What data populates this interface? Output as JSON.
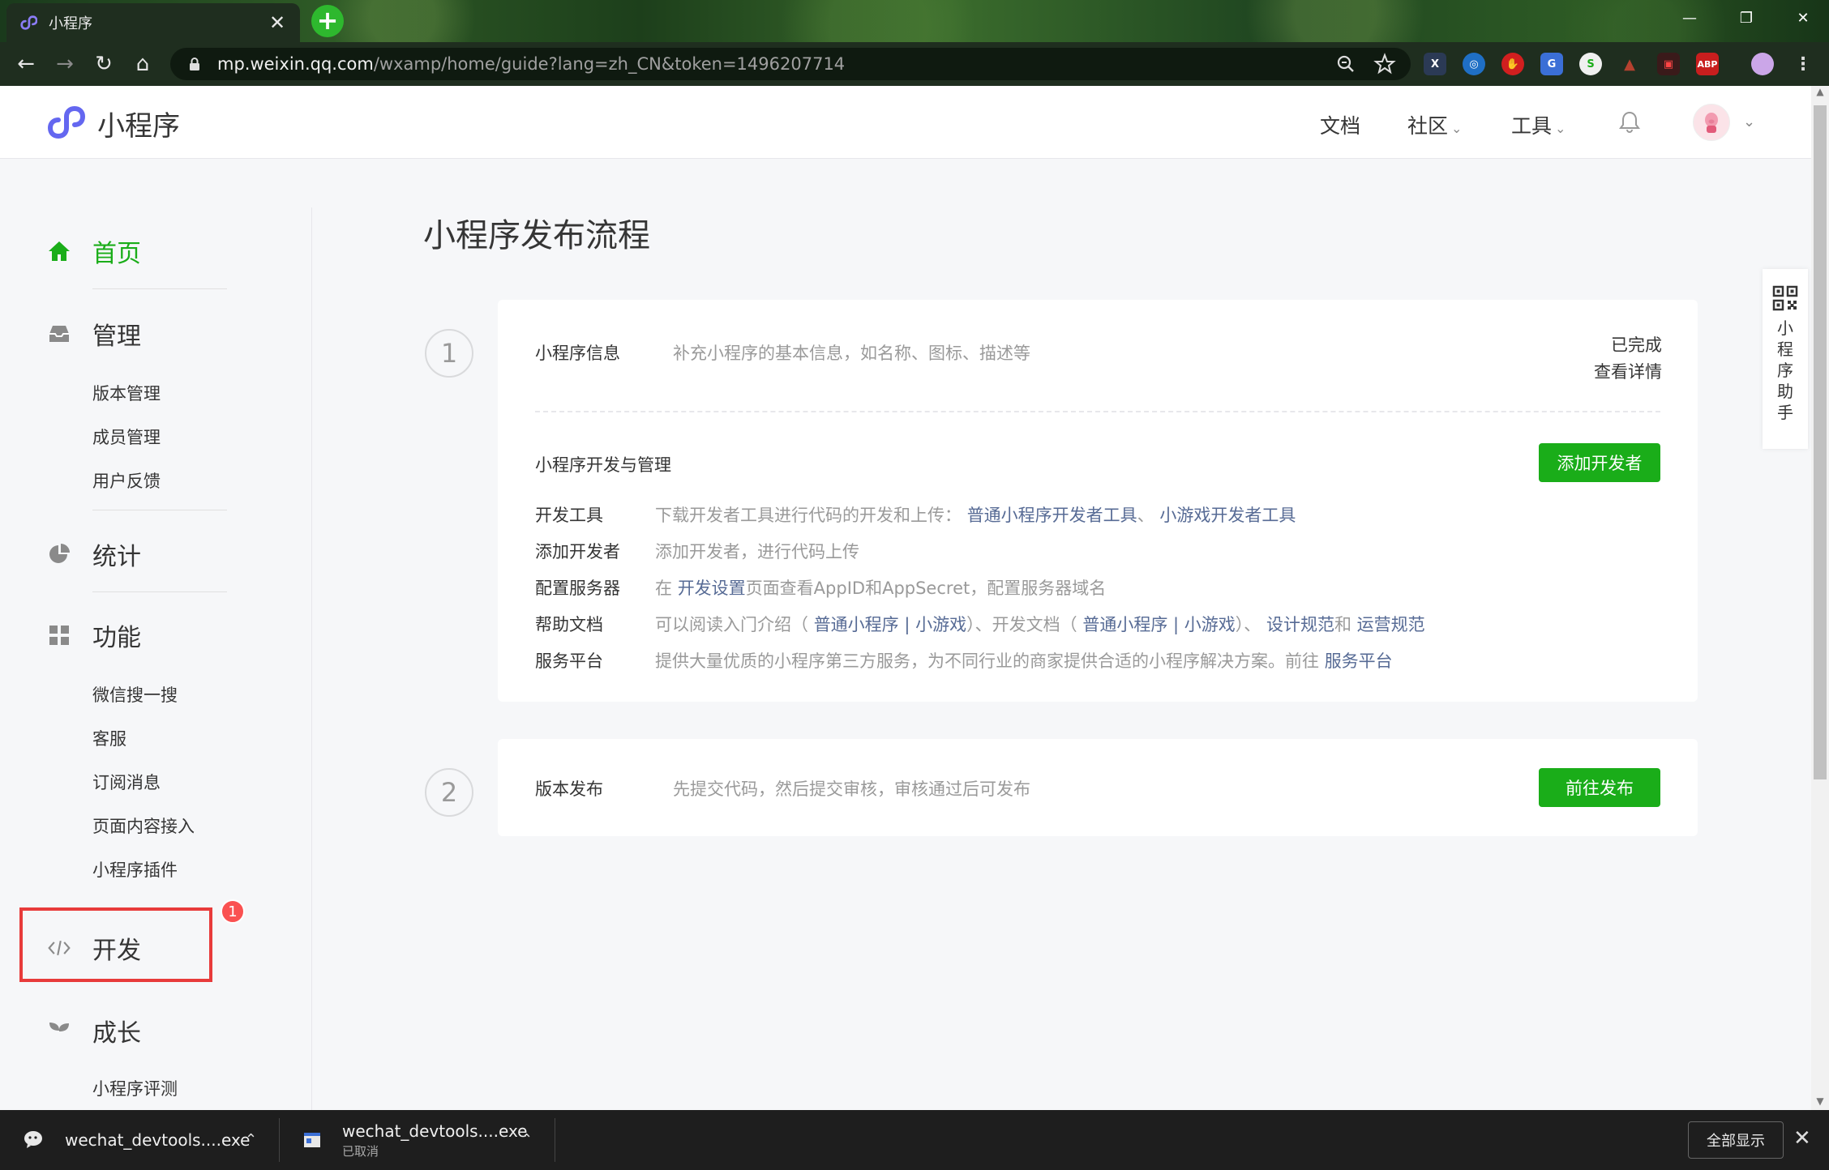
{
  "browser": {
    "tab_title": "小程序",
    "tab_close": "✕",
    "new_tab": "+",
    "url_host": "mp.weixin.qq.com",
    "url_path": "/wxamp/home/guide?lang=zh_CN&token=1496207714",
    "window_controls": {
      "minimize": "—",
      "restore": "❐",
      "close": "✕"
    },
    "nav": {
      "back": "←",
      "forward": "→",
      "reload": "↻",
      "home": "⌂"
    },
    "extensions": [
      "X",
      "◎",
      "✋",
      "G",
      "S",
      "▲",
      "▣",
      "ABP"
    ]
  },
  "header": {
    "logo_text": "小程序",
    "links": {
      "docs": "文档",
      "community": "社区",
      "tools": "工具"
    },
    "chevron": "⌄",
    "brand_color": "#1aad19"
  },
  "sidebar": {
    "home": "首页",
    "manage": {
      "label": "管理",
      "items": [
        "版本管理",
        "成员管理",
        "用户反馈"
      ]
    },
    "stats": {
      "label": "统计"
    },
    "features": {
      "label": "功能",
      "items": [
        "微信搜一搜",
        "客服",
        "订阅消息",
        "页面内容接入",
        "小程序插件"
      ]
    },
    "develop": {
      "label": "开发",
      "badge": "1"
    },
    "growth": {
      "label": "成长",
      "items": [
        "小程序评测"
      ]
    }
  },
  "main": {
    "title": "小程序发布流程",
    "step1": {
      "number": "1",
      "info_label": "小程序信息",
      "info_desc": "补充小程序的基本信息，如名称、图标、描述等",
      "status": "已完成",
      "detail_link": "查看详情",
      "dev_title": "小程序开发与管理",
      "add_dev_button": "添加开发者",
      "rows": {
        "tools": {
          "label": "开发工具",
          "desc": "下载开发者工具进行代码的开发和上传：",
          "link1": "普通小程序开发者工具",
          "sep": "、",
          "link2": "小游戏开发者工具"
        },
        "add_dev": {
          "label": "添加开发者",
          "desc": "添加开发者，进行代码上传"
        },
        "server": {
          "label": "配置服务器",
          "pre": "在",
          "link": "开发设置",
          "post": "页面查看AppID和AppSecret，配置服务器域名"
        },
        "help": {
          "label": "帮助文档",
          "pre": "可以阅读入门介绍（",
          "link1": "普通小程序",
          "bar1": "|",
          "link2": "小游戏",
          "mid": "）、开发文档（",
          "link3": "普通小程序",
          "bar2": "|",
          "link4": "小游戏",
          "mid2": "）、",
          "link5": "设计规范",
          "and": "和",
          "link6": "运营规范"
        },
        "platform": {
          "label": "服务平台",
          "desc": "提供大量优质的小程序第三方服务，为不同行业的商家提供合适的小程序解决方案。前往",
          "link": "服务平台"
        }
      }
    },
    "step2": {
      "number": "2",
      "label": "版本发布",
      "desc": "先提交代码，然后提交审核，审核通过后可发布",
      "button": "前往发布"
    }
  },
  "assistant": {
    "chars": [
      "小",
      "程",
      "序",
      "助",
      "手"
    ]
  },
  "downloads": {
    "item1": {
      "name": "wechat_devtools....exe"
    },
    "item2": {
      "name": "wechat_devtools....exe",
      "status": "已取消"
    },
    "show_all": "全部显示",
    "close": "✕",
    "chevron": "⌃"
  }
}
